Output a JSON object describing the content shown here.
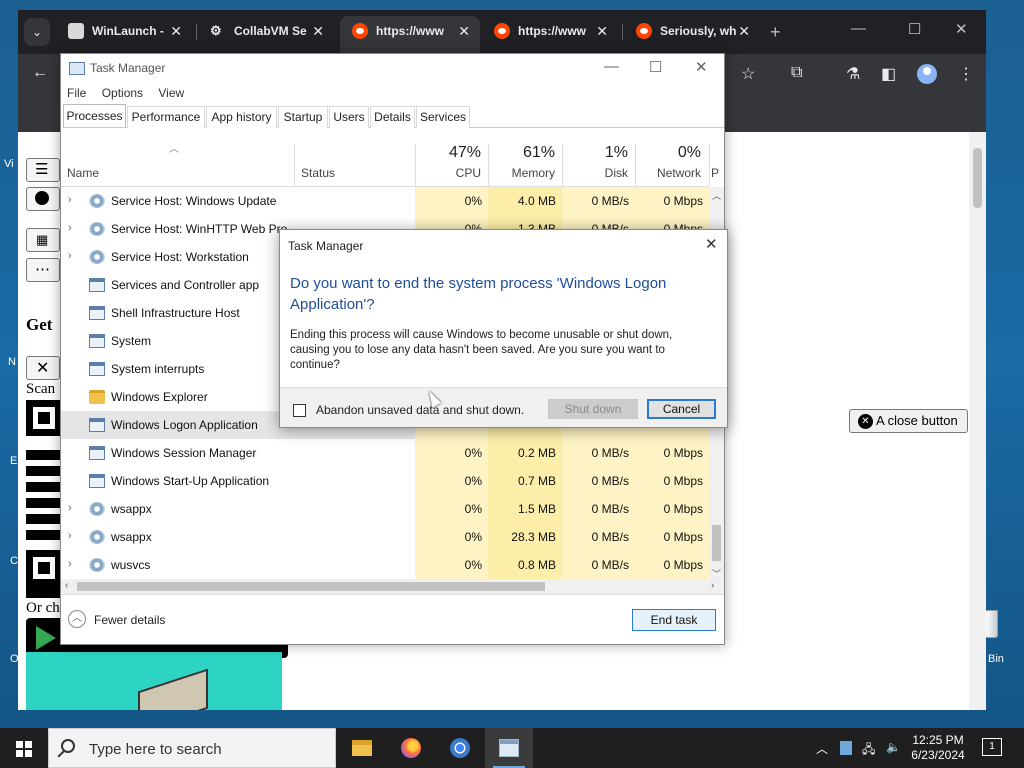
{
  "desktop": {
    "fragments": [
      "Vi",
      "N",
      "E",
      "C",
      "O",
      "Bin"
    ]
  },
  "browser": {
    "tabs": [
      {
        "title": "WinLaunch -",
        "icon": "winlaunch-icon"
      },
      {
        "title": "CollabVM Se",
        "icon": "collabvm-icon"
      },
      {
        "title": "https://www",
        "icon": "reddit-icon",
        "active": true
      },
      {
        "title": "https://www",
        "icon": "reddit-icon"
      },
      {
        "title": "Seriously, wh",
        "icon": "reddit-icon"
      }
    ],
    "tab_close": "✕",
    "new_tab": "+",
    "page": {
      "text_get": "Get",
      "text_scan": "Scan",
      "text_or": "Or ch",
      "close_button_label": "A close button"
    }
  },
  "task_manager": {
    "title": "Task Manager",
    "menu": [
      "File",
      "Options",
      "View"
    ],
    "tabs": [
      "Processes",
      "Performance",
      "App history",
      "Startup",
      "Users",
      "Details",
      "Services"
    ],
    "active_tab": "Processes",
    "columns": {
      "name": "Name",
      "status": "Status",
      "cpu": {
        "pct": "47%",
        "label": "CPU"
      },
      "memory": {
        "pct": "61%",
        "label": "Memory"
      },
      "disk": {
        "pct": "1%",
        "label": "Disk"
      },
      "network": {
        "pct": "0%",
        "label": "Network"
      },
      "power_partial": "P"
    },
    "processes": [
      {
        "name": "Service Host: Windows Update",
        "icon": "gear-icon",
        "expandable": true,
        "cpu": "0%",
        "memory": "4.0 MB",
        "disk": "0 MB/s",
        "network": "0 Mbps"
      },
      {
        "name": "Service Host: WinHTTP Web Pro",
        "icon": "gear-icon",
        "expandable": true,
        "cpu": "0%",
        "memory": "1.3 MB",
        "disk": "0 MB/s",
        "network": "0 Mbps"
      },
      {
        "name": "Service Host: Workstation",
        "icon": "gear-icon",
        "expandable": true,
        "cpu": "",
        "memory": "",
        "disk": "",
        "network": ""
      },
      {
        "name": "Services and Controller app",
        "icon": "window-icon",
        "expandable": false,
        "cpu": "",
        "memory": "",
        "disk": "",
        "network": ""
      },
      {
        "name": "Shell Infrastructure Host",
        "icon": "window-icon",
        "expandable": false,
        "cpu": "",
        "memory": "",
        "disk": "",
        "network": ""
      },
      {
        "name": "System",
        "icon": "window-icon",
        "expandable": false,
        "cpu": "",
        "memory": "",
        "disk": "",
        "network": ""
      },
      {
        "name": "System interrupts",
        "icon": "window-icon",
        "expandable": false,
        "cpu": "",
        "memory": "",
        "disk": "",
        "network": ""
      },
      {
        "name": "Windows Explorer",
        "icon": "folder-icon",
        "expandable": false,
        "cpu": "",
        "memory": "",
        "disk": "",
        "network": ""
      },
      {
        "name": "Windows Logon Application",
        "icon": "window-icon",
        "expandable": false,
        "selected": true,
        "cpu": "",
        "memory": "",
        "disk": "",
        "network": ""
      },
      {
        "name": "Windows Session Manager",
        "icon": "window-icon",
        "expandable": false,
        "cpu": "0%",
        "memory": "0.2 MB",
        "disk": "0 MB/s",
        "network": "0 Mbps"
      },
      {
        "name": "Windows Start-Up Application",
        "icon": "window-icon",
        "expandable": false,
        "cpu": "0%",
        "memory": "0.7 MB",
        "disk": "0 MB/s",
        "network": "0 Mbps"
      },
      {
        "name": "wsappx",
        "icon": "gear-icon",
        "expandable": true,
        "cpu": "0%",
        "memory": "1.5 MB",
        "disk": "0 MB/s",
        "network": "0 Mbps"
      },
      {
        "name": "wsappx",
        "icon": "gear-icon",
        "expandable": true,
        "cpu": "0%",
        "memory": "28.3 MB",
        "disk": "0 MB/s",
        "network": "0 Mbps"
      },
      {
        "name": "wusvcs",
        "icon": "gear-icon",
        "expandable": true,
        "cpu": "0%",
        "memory": "0.8 MB",
        "disk": "0 MB/s",
        "network": "0 Mbps"
      }
    ],
    "fewer_details": "Fewer details",
    "end_task": "End task"
  },
  "dialog": {
    "title": "Task Manager",
    "question": "Do you want to end the system process 'Windows Logon Application'?",
    "message": "Ending this process will cause Windows to become unusable or shut down, causing you to lose any data hasn't been saved. Are you sure you want to continue?",
    "checkbox_label": "Abandon unsaved data and shut down.",
    "checkbox_checked": false,
    "shutdown_button": "Shut down",
    "cancel_button": "Cancel"
  },
  "taskbar": {
    "search_placeholder": "Type here to search",
    "apps": [
      "file-explorer-icon",
      "firefox-icon",
      "chrome-icon",
      "task-manager-icon"
    ],
    "time": "12:25 PM",
    "date": "6/23/2024",
    "notification_count": "1"
  },
  "colors": {
    "dialog_heading": "#1f4e98",
    "selection": "#e5e5e5",
    "heat_cell": "#fdf3c4",
    "accent": "#2a7ad2"
  }
}
